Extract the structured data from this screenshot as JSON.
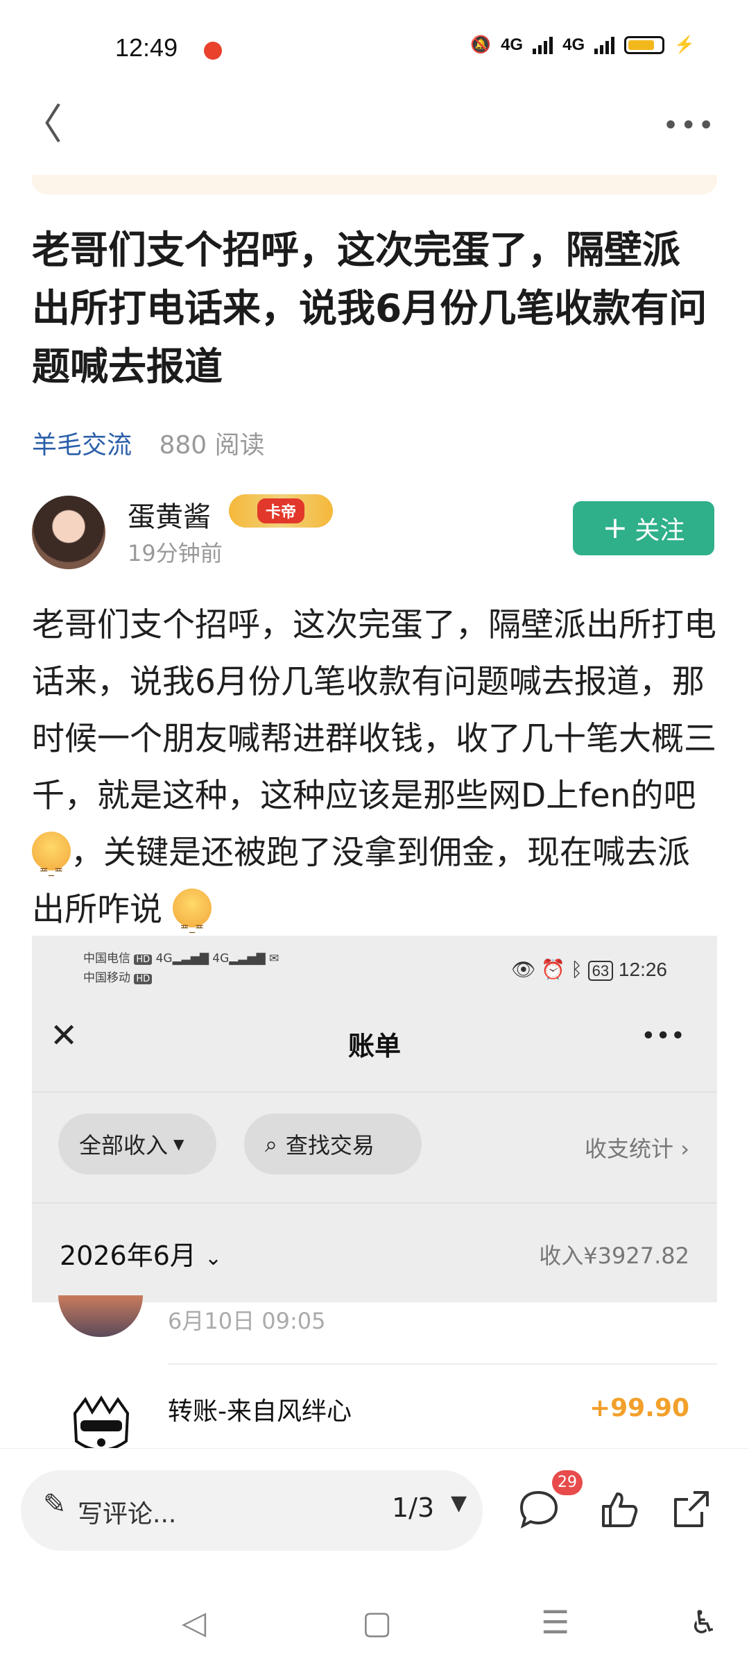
{
  "status_bar": {
    "time": "12:49",
    "signal1": "4G",
    "signal2": "4G"
  },
  "nav": {
    "back_icon": "chevron-left-icon",
    "more_icon": "more-horizontal-icon"
  },
  "post": {
    "title": "老哥们支个招呼，这次完蛋了，隔壁派出所打电话来，说我6月份几笔收款有问题喊去报道",
    "category": "羊毛交流",
    "reads": "880 阅读",
    "author": "蛋黄酱",
    "badge": "卡帝",
    "time_ago": "19分钟前",
    "follow_label": "关注",
    "body_part1": "老哥们支个招呼，这次完蛋了，隔壁派出所打电话来，说我6月份几笔收款有问题喊去报道，那时候一个朋友喊帮进群收钱，收了几十笔大概三千，就是这种，这种应该是那些网D上fen的吧",
    "body_part2": "，关键是还被跑了没拿到佣金，现在喊去派出所咋说"
  },
  "embedded": {
    "carrier1": "中国电信",
    "carrier2": "中国移动",
    "hd1": "HD",
    "hd2": "HD",
    "battery": "63",
    "time": "12:26",
    "title": "账单",
    "filter": "全部收入",
    "search": "查找交易",
    "stats": "收支统计",
    "month": "2026年6月",
    "income": "收入¥3927.82",
    "tx1_time": "6月10日 09:05",
    "tx2_name": "转账-来自风绊心",
    "tx2_amount": "+99.90"
  },
  "bottom_bar": {
    "comment_placeholder": "写评论...",
    "pager": "1/3",
    "comment_count": "29"
  }
}
